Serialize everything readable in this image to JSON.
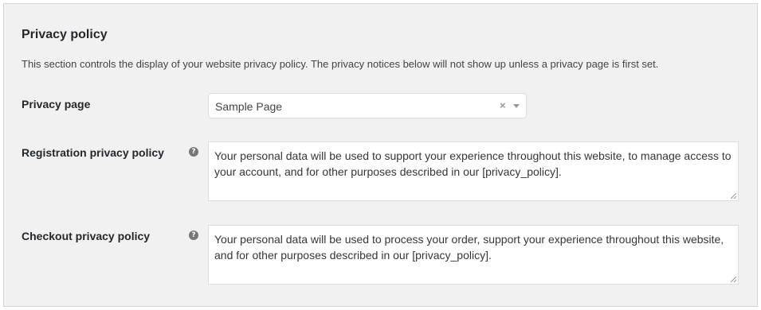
{
  "section": {
    "title": "Privacy policy",
    "description": "This section controls the display of your website privacy policy. The privacy notices below will not show up unless a privacy page is first set."
  },
  "privacy_page": {
    "label": "Privacy page",
    "selected": "Sample Page",
    "clear_glyph": "×"
  },
  "registration_policy": {
    "label": "Registration privacy policy",
    "help_glyph": "?",
    "value": "Your personal data will be used to support your experience throughout this website, to manage access to your account, and for other purposes described in our [privacy_policy]."
  },
  "checkout_policy": {
    "label": "Checkout privacy policy",
    "help_glyph": "?",
    "value": "Your personal data will be used to process your order, support your experience throughout this website, and for other purposes described in our [privacy_policy]."
  }
}
